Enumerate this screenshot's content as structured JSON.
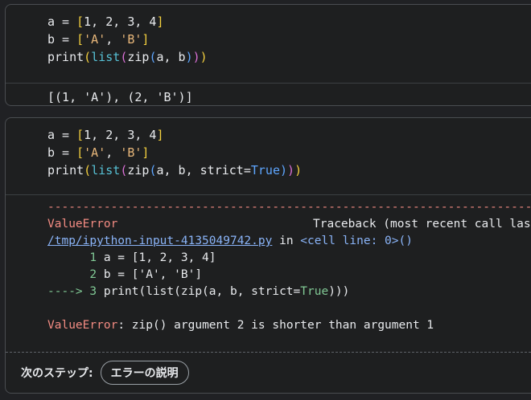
{
  "cell1": {
    "code": {
      "line1": {
        "a": "a = ",
        "lb": "[",
        "vals": "1, 2, 3, 4",
        "rb": "]"
      },
      "line2": {
        "a": "b = ",
        "lb": "[",
        "s1": "'A'",
        "sep": ", ",
        "s2": "'B'",
        "rb": "]"
      },
      "line3": {
        "print": "print",
        "p1": "(",
        "list": "list",
        "p2": "(",
        "zip": "zip",
        "p3": "(",
        "args": "a, b",
        "close3": ")",
        "close2": ")",
        "close1": ")"
      }
    },
    "output": "[(1, 'A'), (2, 'B')]"
  },
  "cell2": {
    "code": {
      "line1": {
        "a": "a = ",
        "lb": "[",
        "vals": "1, 2, 3, 4",
        "rb": "]"
      },
      "line2": {
        "a": "b = ",
        "lb": "[",
        "s1": "'A'",
        "sep": ", ",
        "s2": "'B'",
        "rb": "]"
      },
      "line3": {
        "print": "print",
        "p1": "(",
        "list": "list",
        "p2": "(",
        "zip": "zip",
        "p3": "(",
        "args": "a, b, strict=",
        "true": "True",
        "close3": ")",
        "close2": ")",
        "close1": ")"
      }
    },
    "traceback": {
      "dashes": "---------------------------------------------------------------------------",
      "error_name": "ValueError",
      "traceback_header": "Traceback (most recent call last)",
      "file_link": "/tmp/ipython-input-4135049742.py",
      "in_text": " in ",
      "cell_line": "<cell line: 0>()",
      "ctx1_no": "      1",
      "ctx1_code": " a = [1, 2, 3, 4]",
      "ctx2_no": "      2",
      "ctx2_code": " b = ['A', 'B']",
      "arrow": "----> 3",
      "ctx3_code_a": " print(list(zip(a, b, strict=",
      "ctx3_true": "True",
      "ctx3_code_b": ")))",
      "final_error": "ValueError",
      "final_message": ": zip() argument 2 is shorter than argument 1"
    },
    "footer": {
      "label": "次のステップ:",
      "button": "エラーの説明"
    }
  }
}
